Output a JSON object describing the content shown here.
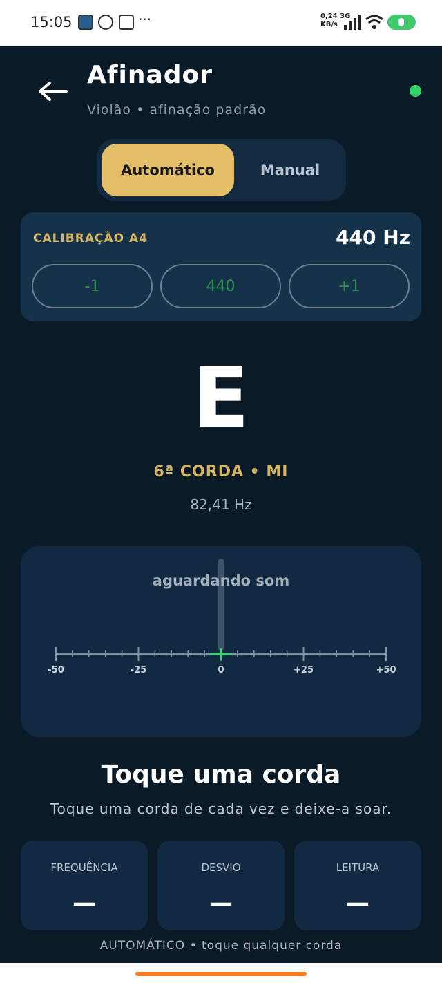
{
  "status_bar": {
    "time": "15:05",
    "more": "···",
    "net_speed_top": "0,24",
    "net_type": "3G",
    "net_speed_unit": "KB/s"
  },
  "header": {
    "title": "Afinador",
    "subtitle": "Violão • afinação padrão",
    "status_color": "#34d36c"
  },
  "mode": {
    "auto_label": "Automático",
    "manual_label": "Manual",
    "selected": "auto"
  },
  "calibration": {
    "label": "CALIBRAÇÃO A4",
    "value": "440 Hz",
    "buttons": [
      "-1",
      "440",
      "+1"
    ]
  },
  "note": {
    "name": "E",
    "string_label": "6ª CORDA • MI",
    "frequency": "82,41 Hz"
  },
  "meter": {
    "status": "aguardando som",
    "ticks": [
      "-50",
      "-25",
      "0",
      "+25",
      "+50"
    ],
    "range": [
      -50,
      50
    ],
    "needle_cents": 0
  },
  "prompt": {
    "title": "Toque uma corda",
    "subtitle": "Toque uma corda de cada vez e deixe-a soar."
  },
  "stats": [
    {
      "label": "FREQUÊNCIA",
      "value": "—"
    },
    {
      "label": "DESVIO",
      "value": "—"
    },
    {
      "label": "LEITURA",
      "value": "—"
    }
  ],
  "footer": {
    "mode_text": "AUTOMÁTICO • toque qualquer corda"
  },
  "colors": {
    "background": "#0a1a26",
    "accent_gold": "#e3be66",
    "accent_green": "#34d36c",
    "card": "#16314a"
  }
}
